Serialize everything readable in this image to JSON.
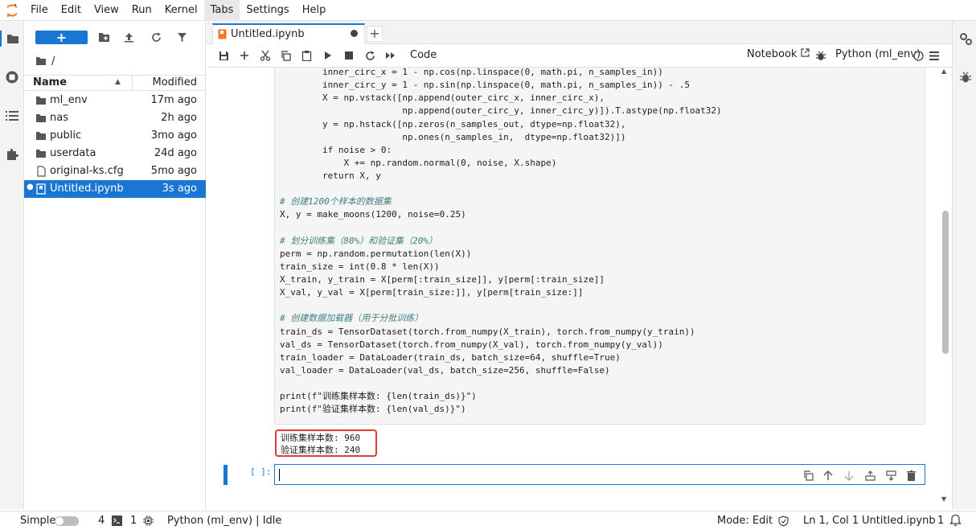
{
  "menubar": {
    "items": [
      "File",
      "Edit",
      "View",
      "Run",
      "Kernel",
      "Tabs",
      "Settings",
      "Help"
    ],
    "active": "Tabs"
  },
  "filebrowser": {
    "new_label": "+",
    "path": "/",
    "header": {
      "name": "Name",
      "modified": "Modified"
    },
    "files": [
      {
        "name": "ml_env",
        "modified": "17m ago",
        "type": "folder"
      },
      {
        "name": "nas",
        "modified": "2h ago",
        "type": "folder"
      },
      {
        "name": "public",
        "modified": "3mo ago",
        "type": "folder"
      },
      {
        "name": "userdata",
        "modified": "24d ago",
        "type": "folder"
      },
      {
        "name": "original-ks.cfg",
        "modified": "5mo ago",
        "type": "file"
      },
      {
        "name": "Untitled.ipynb",
        "modified": "3s ago",
        "type": "notebook",
        "selected": true
      }
    ]
  },
  "tabs": {
    "active_label": "Untitled.ipynb",
    "add_label": "+"
  },
  "toolbar": {
    "cell_type": "Code",
    "notebook_link": "Notebook",
    "kernel": "Python (ml_env)"
  },
  "code": {
    "lines": [
      "        inner_circ_x = 1 - np.cos(np.linspace(0, math.pi, n_samples_in))",
      "        inner_circ_y = 1 - np.sin(np.linspace(0, math.pi, n_samples_in)) - .5",
      "        X = np.vstack([np.append(outer_circ_x, inner_circ_x),",
      "                       np.append(outer_circ_y, inner_circ_y)]).T.astype(np.float32)",
      "        y = np.hstack([np.zeros(n_samples_out, dtype=np.float32),",
      "                       np.ones(n_samples_in,  dtype=np.float32)])",
      "        if noise > 0:",
      "            X += np.random.normal(0, noise, X.shape)",
      "        return X, y",
      "",
      "# 创建1200个样本的数据集",
      "X, y = make_moons(1200, noise=0.25)",
      "",
      "# 划分训练集（80%）和验证集（20%）",
      "perm = np.random.permutation(len(X))",
      "train_size = int(0.8 * len(X))",
      "X_train, y_train = X[perm[:train_size]], y[perm[:train_size]]",
      "X_val, y_val = X[perm[train_size:]], y[perm[train_size:]]",
      "",
      "# 创建数据加载器（用于分批训练）",
      "train_ds = TensorDataset(torch.from_numpy(X_train), torch.from_numpy(y_train))",
      "val_ds = TensorDataset(torch.from_numpy(X_val), torch.from_numpy(y_val))",
      "train_loader = DataLoader(train_ds, batch_size=64, shuffle=True)",
      "val_loader = DataLoader(val_ds, batch_size=256, shuffle=False)",
      "",
      "print(f\"训练集样本数: {len(train_ds)}\")",
      "print(f\"验证集样本数: {len(val_ds)}\")"
    ]
  },
  "output": {
    "lines": [
      "训练集样本数: 960",
      "验证集样本数: 240"
    ]
  },
  "input_cell": {
    "prompt": "[ ]:"
  },
  "statusbar": {
    "mode_label": "Simple",
    "terminals": "4",
    "kernels": "1",
    "kernel_status": "Python (ml_env) | Idle",
    "mode": "Mode: Edit",
    "position": "Ln 1, Col 1",
    "filename": "Untitled.ipynb",
    "notifications": "1"
  },
  "colors": {
    "accent": "#1976d2",
    "output_highlight": "#e53935"
  }
}
